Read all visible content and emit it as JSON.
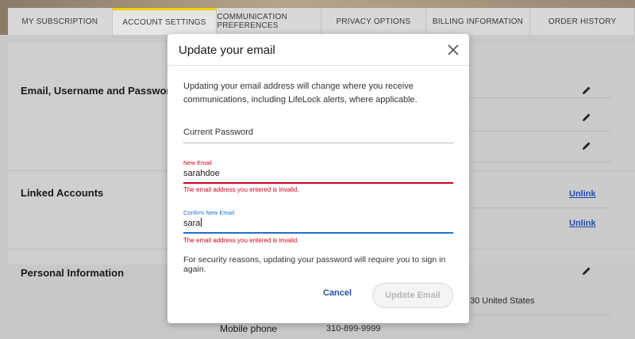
{
  "tabs": [
    {
      "label": "MY SUBSCRIPTION"
    },
    {
      "label": "ACCOUNT SETTINGS"
    },
    {
      "label": "COMMUNICATION PREFERENCES"
    },
    {
      "label": "PRIVACY OPTIONS"
    },
    {
      "label": "BILLING INFORMATION"
    },
    {
      "label": "ORDER HISTORY"
    }
  ],
  "active_tab": "ACCOUNT SETTINGS",
  "background": {
    "sections": [
      {
        "title": "Email, Username and Password"
      },
      {
        "title": "Linked Accounts",
        "links": [
          "Unlink",
          "Unlink"
        ]
      },
      {
        "title": "Personal Information"
      }
    ],
    "address_partial": "30 United States",
    "mobile_label": "Mobile phone",
    "mobile_value": "310-899-9999"
  },
  "modal": {
    "title": "Update your email",
    "intro": "Updating your email address will change where you receive communications, including LifeLock alerts, where applicable.",
    "current_password": {
      "placeholder": "Current Password",
      "value": ""
    },
    "new_email": {
      "label": "New Email",
      "value": "sarahdoe",
      "error": "The email address you entered is invalid."
    },
    "confirm_email": {
      "label": "Confirm New Email",
      "value": "sara",
      "error": "The email address you entered is invalid."
    },
    "security_note": "For security reasons, updating your password will require you to sign in again.",
    "cancel_label": "Cancel",
    "update_label": "Update Email"
  },
  "colors": {
    "error": "#d0021b",
    "focus": "#1f6fd1",
    "link": "#1f4fb5",
    "tab_accent": "#f0d000"
  }
}
